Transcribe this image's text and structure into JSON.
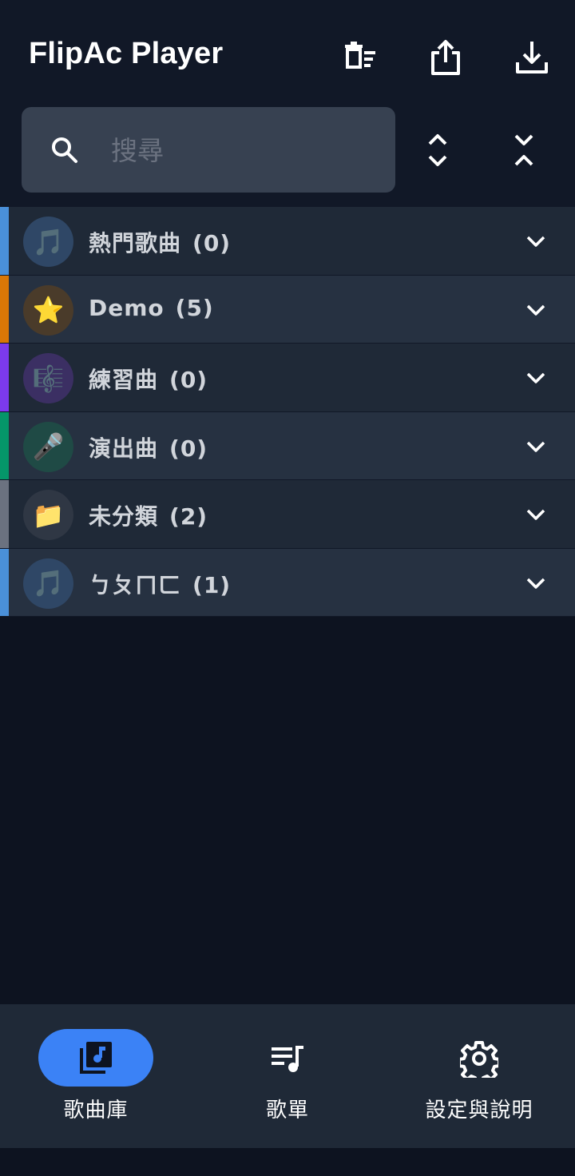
{
  "header": {
    "title": "FlipAc Player",
    "actions": [
      {
        "name": "clear-list-button",
        "icon": "delete-list-icon"
      },
      {
        "name": "share-button",
        "icon": "share-icon"
      },
      {
        "name": "download-button",
        "icon": "download-icon"
      }
    ]
  },
  "search": {
    "placeholder": "搜尋",
    "value": "",
    "expand_all_icon": "expand-all-icon",
    "collapse_all_icon": "collapse-all-icon"
  },
  "categories": [
    {
      "label": "熱門歌曲",
      "count": "(0)",
      "emoji": "🎵",
      "stripe": "#4a90d9",
      "avatar_bg": "#2f4766"
    },
    {
      "label": "Demo",
      "count": "(5)",
      "emoji": "⭐",
      "stripe": "#d97706",
      "avatar_bg": "#4a3b2a"
    },
    {
      "label": "練習曲",
      "count": "(0)",
      "emoji": "🎼",
      "stripe": "#7c3aed",
      "avatar_bg": "#3b2f63"
    },
    {
      "label": "演出曲",
      "count": "(0)",
      "emoji": "🎤",
      "stripe": "#059669",
      "avatar_bg": "#1f4a45"
    },
    {
      "label": "未分類",
      "count": "(2)",
      "emoji": "📁",
      "stripe": "#6b7280",
      "avatar_bg": "#2f3744"
    },
    {
      "label": "ㄅㄆㄇㄈ",
      "count": "(1)",
      "emoji": "🎵",
      "stripe": "#4a90d9",
      "avatar_bg": "#2f4766"
    }
  ],
  "bottom_nav": {
    "items": [
      {
        "label": "歌曲庫",
        "icon": "library-music-icon",
        "active": true
      },
      {
        "label": "歌單",
        "icon": "playlist-icon",
        "active": false
      },
      {
        "label": "設定與說明",
        "icon": "gear-icon",
        "active": false
      }
    ]
  },
  "colors": {
    "accent": "#3b82f6",
    "background": "#0d1320",
    "surface": "#1f2937"
  }
}
